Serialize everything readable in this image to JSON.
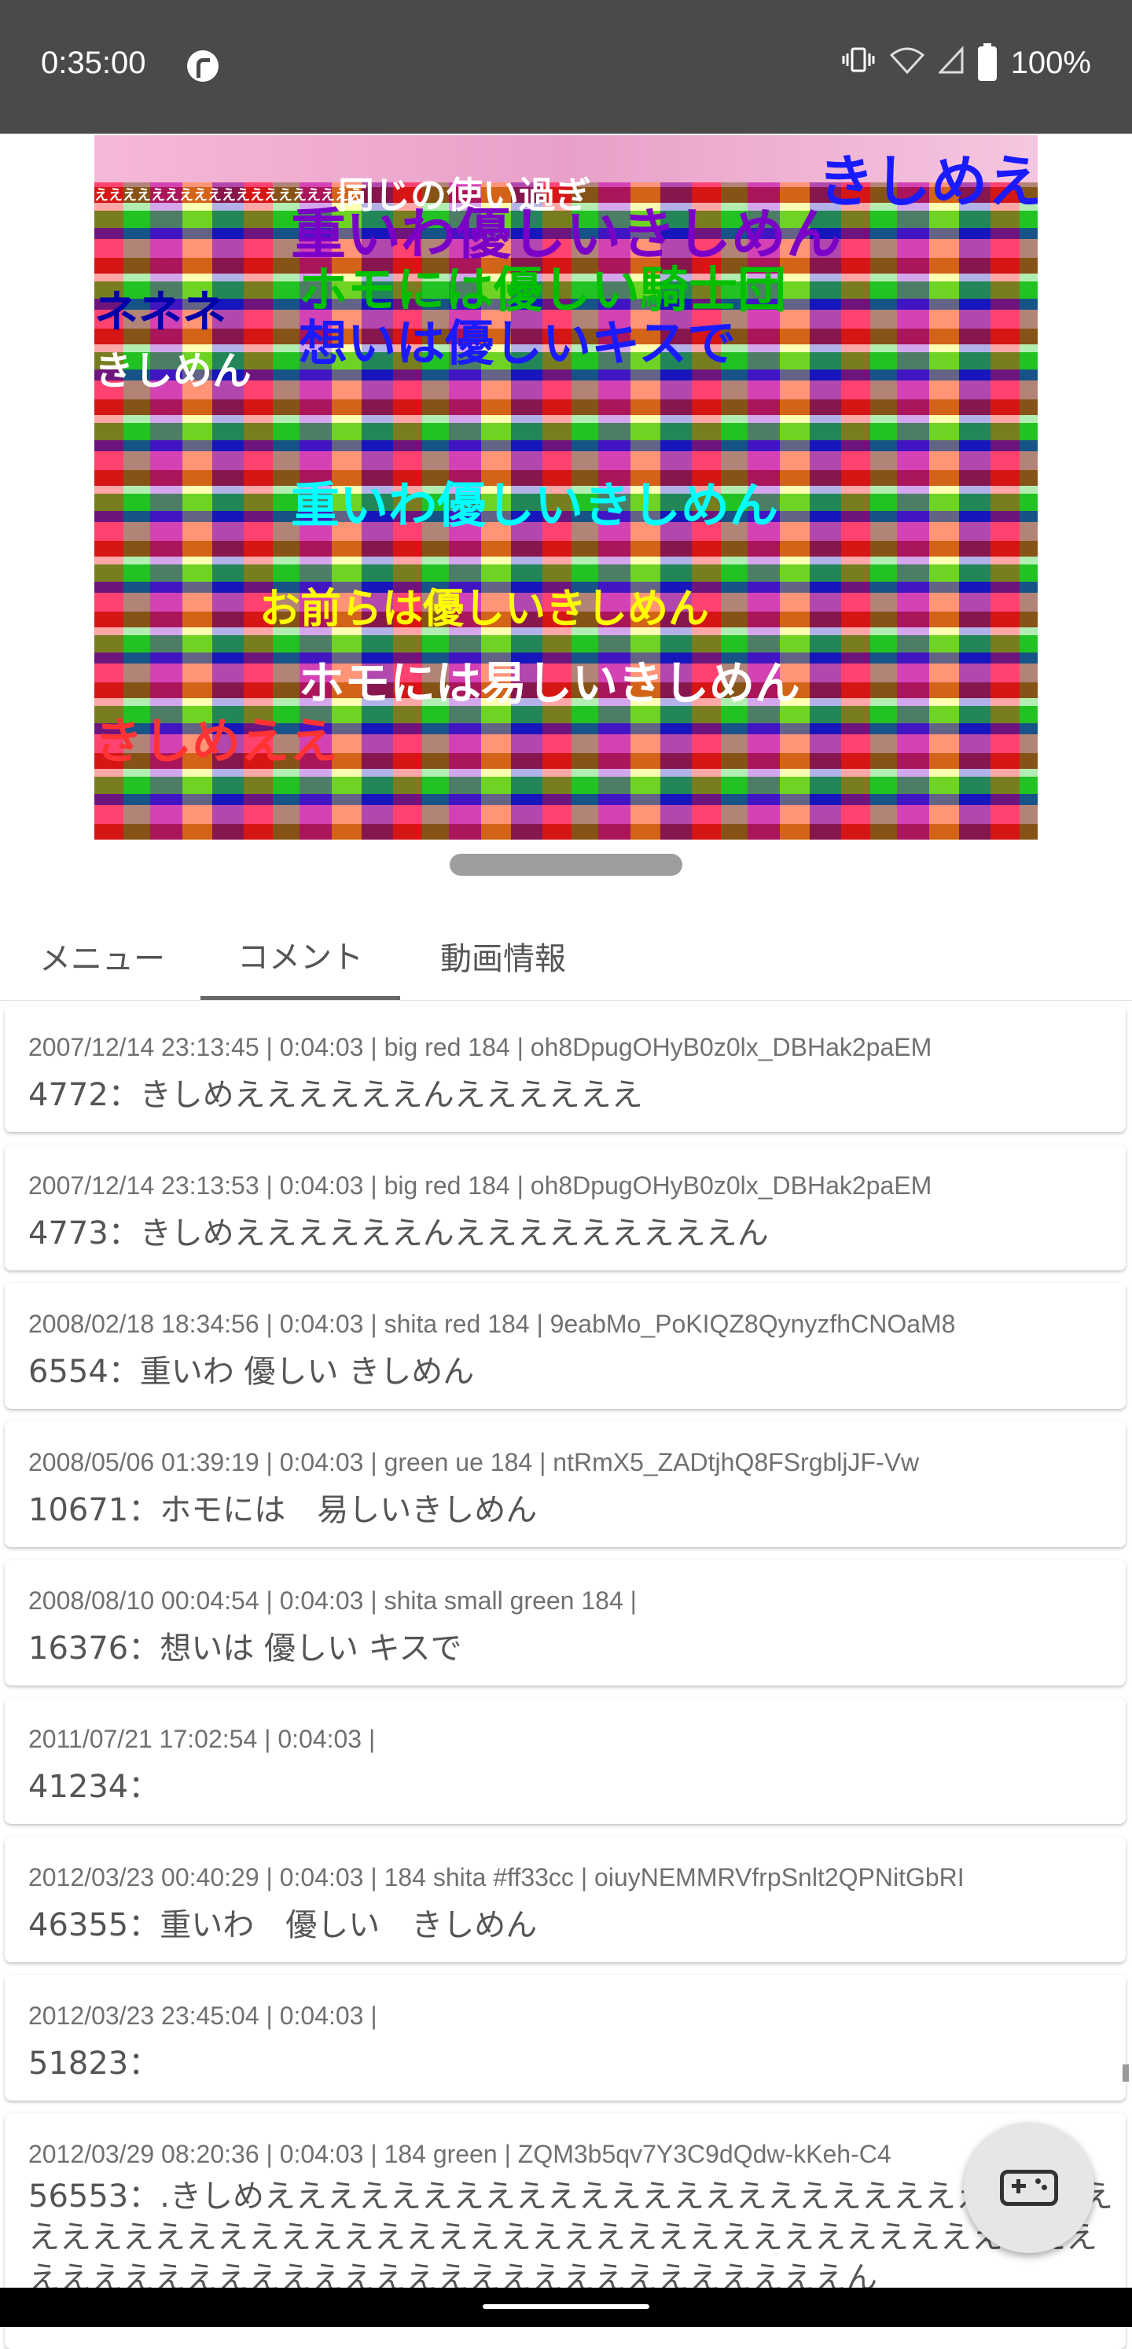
{
  "status_bar": {
    "time": "0:35:00",
    "battery": "100%",
    "icons": [
      "vibrate-icon",
      "wifi-icon",
      "signal-icon",
      "battery-icon"
    ]
  },
  "video_overlay": [
    {
      "text": "きしめえ",
      "color": "#1a1aff"
    },
    {
      "text": "同じの使い過ぎ",
      "color": "#ffffff"
    },
    {
      "text": "えええええええええええええええええええ",
      "color": "#ffffff"
    },
    {
      "text": "重いわ優しいきしめん",
      "color": "#7a00c8"
    },
    {
      "text": "ホモには優しい騎士団",
      "color": "#00c000"
    },
    {
      "text": "想いは優しいキスで",
      "color": "#1a1aff"
    },
    {
      "text": "きしめん",
      "color": "#ffffff"
    },
    {
      "text": "お前らは優しいきしめん",
      "color": "#ffff00"
    },
    {
      "text": "重いわ優しいきしめん",
      "color": "#00ffff"
    },
    {
      "text": "きしめええ",
      "color": "#ff3333"
    },
    {
      "text": "ネネネ",
      "color": "#0000aa"
    },
    {
      "text": "ホモには易しいきしめん",
      "color": "#ffffff"
    }
  ],
  "tabs": [
    {
      "label": "メニュー",
      "active": false
    },
    {
      "label": "コメント",
      "active": true
    },
    {
      "label": "動画情報",
      "active": false
    }
  ],
  "comments": [
    {
      "meta": "2007/12/14 23:13:45 | 0:04:03 | big red 184 | oh8DpugOHyB0z0lx_DBHak2paEM",
      "body": "4772：きしめええええええんええええええ"
    },
    {
      "meta": "2007/12/14 23:13:53 | 0:04:03 | big red 184 | oh8DpugOHyB0z0lx_DBHak2paEM",
      "body": "4773：きしめええええええんえええええええええん"
    },
    {
      "meta": "2008/02/18 18:34:56 | 0:04:03 | shita red 184 | 9eabMo_PoKIQZ8QynyzfhCNOaM8",
      "body": "6554：重いわ  優しい  きしめん"
    },
    {
      "meta": "2008/05/06 01:39:19 | 0:04:03 | green ue 184 | ntRmX5_ZADtjhQ8FSrgbljJF-Vw",
      "body": "10671：ホモには　易しいきしめん"
    },
    {
      "meta": "2008/08/10 00:04:54 | 0:04:03 | shita small green 184 |",
      "body": "16376：想いは 優しい  キスで"
    },
    {
      "meta": "2011/07/21 17:02:54 | 0:04:03 |",
      "body": "41234："
    },
    {
      "meta": "2012/03/23 00:40:29 | 0:04:03 | 184 shita #ff33cc | oiuyNEMMRVfrpSnlt2QPNitGbRI",
      "body": "46355：重いわ　優しい　きしめん"
    },
    {
      "meta": "2012/03/23 23:45:04 | 0:04:03 |",
      "body": "51823："
    },
    {
      "meta": "2012/03/29 08:20:36 | 0:04:03 | 184 green | ZQM3b5qv7Y3C9dQdw-kKeh-C4",
      "body": "56553：.きしめえええええええええええええええええええええええええええええええええええええええええええええええええええええええええええええええええええええええええええええええええええええええん"
    }
  ],
  "fab": {
    "icon": "gamepad-icon"
  }
}
